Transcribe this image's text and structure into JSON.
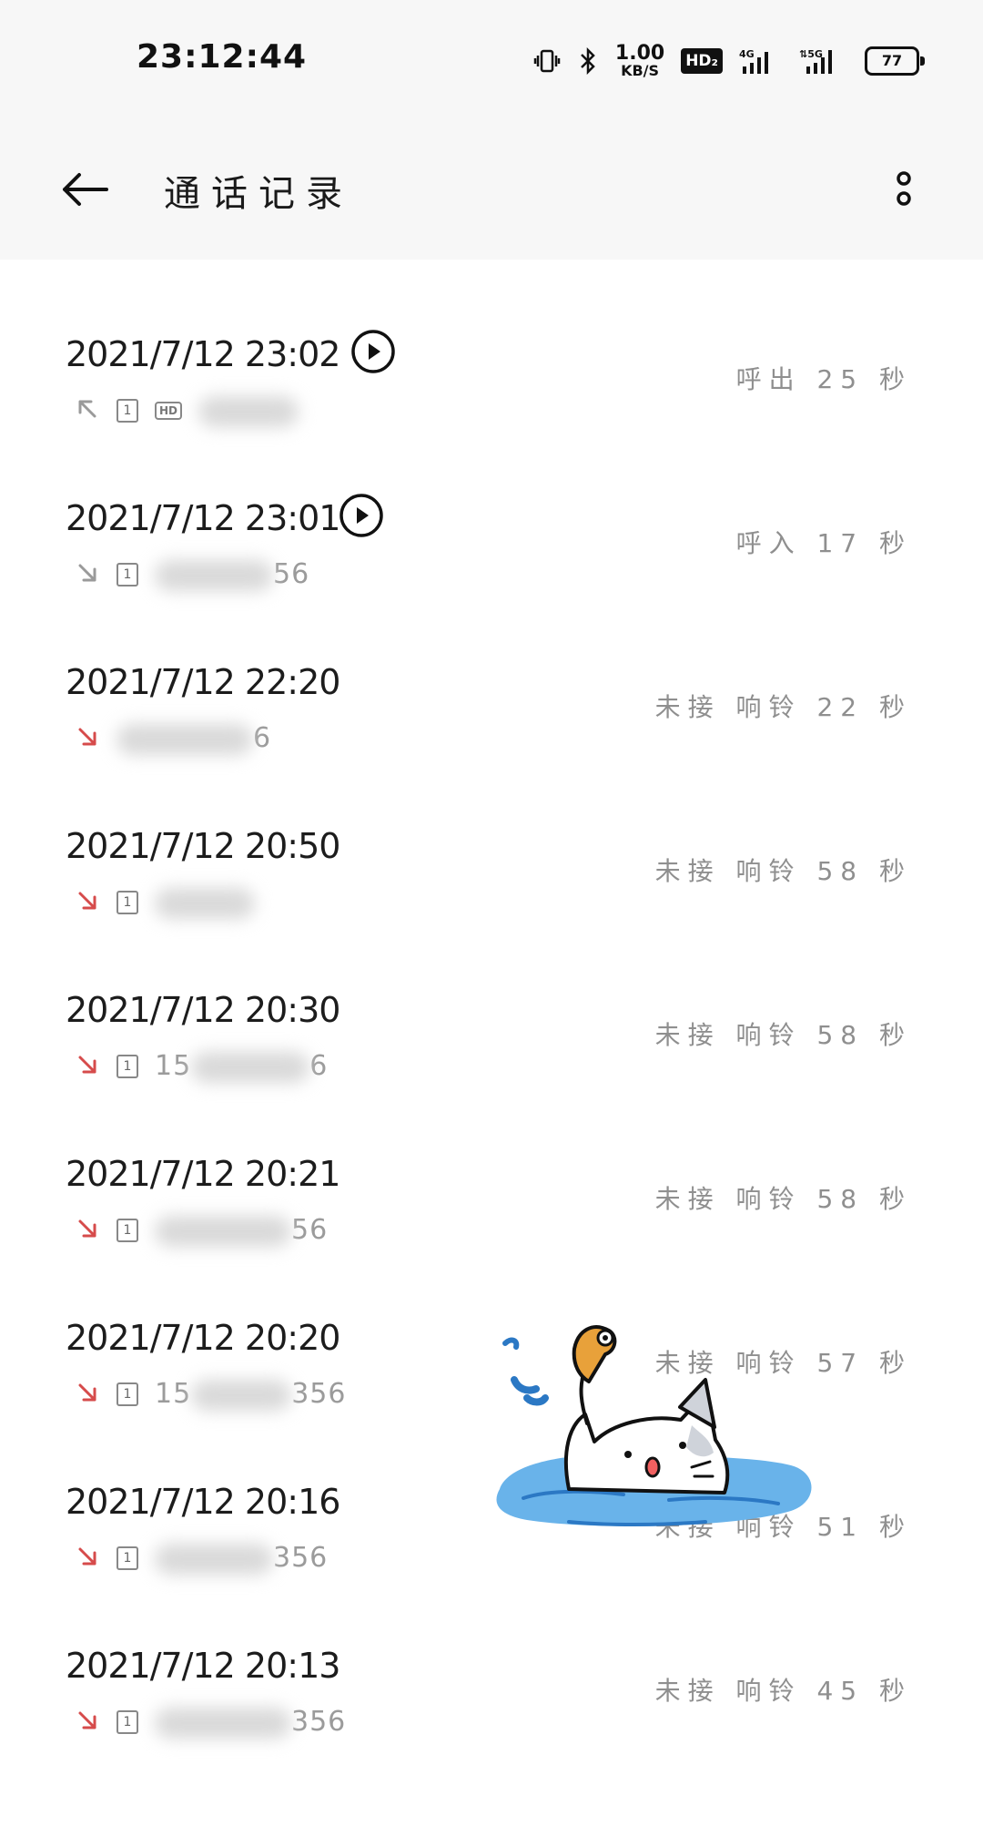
{
  "status_bar": {
    "time": "23:12:44",
    "speed_value": "1.00",
    "speed_unit": "KB/S",
    "hd_badge": "HD₂",
    "net1": "4G",
    "net2": "5G",
    "battery": "77"
  },
  "app_bar": {
    "title": "通话记录",
    "back_icon": "arrow-left-icon",
    "more_icon": "more-vertical-icon"
  },
  "colors": {
    "missed": "#d64b4b",
    "muted": "#8f8f8f",
    "header_bg": "#f7f7f7"
  },
  "records": [
    {
      "datetime": "2021/7/12 23:02",
      "has_recording": true,
      "type": "outgoing",
      "sim": "1",
      "hd": "HD",
      "number_visible": "",
      "number_suffix": "",
      "info": "呼出 25 秒"
    },
    {
      "datetime": "2021/7/12 23:01",
      "has_recording": true,
      "type": "incoming",
      "sim": "1",
      "hd": "",
      "number_visible": "",
      "number_suffix": "56",
      "info": "呼入 17 秒"
    },
    {
      "datetime": "2021/7/12 22:20",
      "has_recording": false,
      "type": "missed",
      "sim": "",
      "hd": "",
      "number_visible": "",
      "number_suffix": "6",
      "info": "未接 响铃 22 秒"
    },
    {
      "datetime": "2021/7/12 20:50",
      "has_recording": false,
      "type": "missed",
      "sim": "1",
      "hd": "",
      "number_visible": "",
      "number_suffix": "",
      "info": "未接 响铃 58 秒"
    },
    {
      "datetime": "2021/7/12 20:30",
      "has_recording": false,
      "type": "missed",
      "sim": "1",
      "hd": "",
      "number_visible": "15",
      "number_suffix": "6",
      "info": "未接 响铃 58 秒"
    },
    {
      "datetime": "2021/7/12 20:21",
      "has_recording": false,
      "type": "missed",
      "sim": "1",
      "hd": "",
      "number_visible": "",
      "number_suffix": "56",
      "info": "未接 响铃 58 秒"
    },
    {
      "datetime": "2021/7/12 20:20",
      "has_recording": false,
      "type": "missed",
      "sim": "1",
      "hd": "",
      "number_visible": "15",
      "number_suffix": "356",
      "info": "未接 响铃 57 秒"
    },
    {
      "datetime": "2021/7/12 20:16",
      "has_recording": false,
      "type": "missed",
      "sim": "1",
      "hd": "",
      "number_visible": "",
      "number_suffix": "356",
      "info": "未接 响铃 51 秒"
    },
    {
      "datetime": "2021/7/12 20:13",
      "has_recording": false,
      "type": "missed",
      "sim": "1",
      "hd": "",
      "number_visible": "",
      "number_suffix": "356",
      "info": "未接 响铃 45 秒"
    }
  ]
}
